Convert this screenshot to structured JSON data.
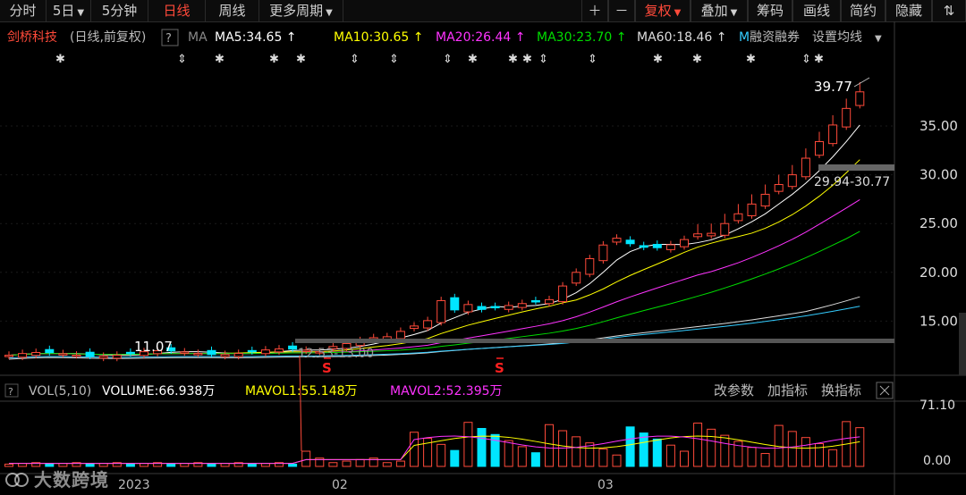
{
  "toolbar": {
    "items": [
      {
        "label": "分时",
        "caret": false
      },
      {
        "label": "5日",
        "caret": true
      },
      {
        "label": "5分钟",
        "caret": false
      },
      {
        "label": "日线",
        "caret": false,
        "active": true
      },
      {
        "label": "周线",
        "caret": false
      },
      {
        "label": "更多周期",
        "caret": true
      }
    ],
    "right_items": [
      {
        "label": "＋"
      },
      {
        "label": "－"
      },
      {
        "label": "复权",
        "caret": true,
        "red": true
      },
      {
        "label": "叠加",
        "caret": true
      },
      {
        "label": "筹码"
      },
      {
        "label": "画线"
      },
      {
        "label": "简约"
      },
      {
        "label": "隐藏"
      },
      {
        "label": "⇅"
      }
    ]
  },
  "header": {
    "stock_name": "剑桥科技",
    "mode": "(日线,前复权)",
    "help": "?",
    "ma_label": "MA",
    "ma": [
      {
        "label": "MA5:34.65",
        "color": "#ffffff"
      },
      {
        "label": "MA10:30.65",
        "color": "#ffff00"
      },
      {
        "label": "MA20:26.44",
        "color": "#ff33ff"
      },
      {
        "label": "MA30:23.70",
        "color": "#00dd00"
      },
      {
        "label": "MA60:18.46",
        "color": "#dddddd"
      },
      {
        "label": "M",
        "color": "#33ccff"
      }
    ],
    "margin_label": "融资融券",
    "set_ma_label": "设置均线"
  },
  "price_axis": {
    "ticks": [
      "35.00",
      "30.00",
      "25.00",
      "20.00",
      "15.00"
    ]
  },
  "annotations": {
    "high": "39.77",
    "low": "11.07",
    "range_high": "29.94-30.77",
    "range_low": "12.53-13.00",
    "s_mark": "S"
  },
  "volume": {
    "label": "VOL(5,10)",
    "volume": "VOLUME:66.938万",
    "mavol1": "MAVOL1:55.148万",
    "mavol2": "MAVOL2:52.395万",
    "modify": "改参数",
    "add": "加指标",
    "switch": "换指标",
    "ticks": [
      "71.10",
      "0.00"
    ]
  },
  "dates": [
    "2023",
    "02",
    "03"
  ],
  "watermark": "大数跨境",
  "colors": {
    "up": "#ff4a3a",
    "down": "#00e5ff",
    "ma5": "#ffffff",
    "ma10": "#ffff00",
    "ma20": "#ff33ff",
    "ma30": "#00dd00",
    "ma60": "#dddddd",
    "ma120": "#33ccff"
  }
}
